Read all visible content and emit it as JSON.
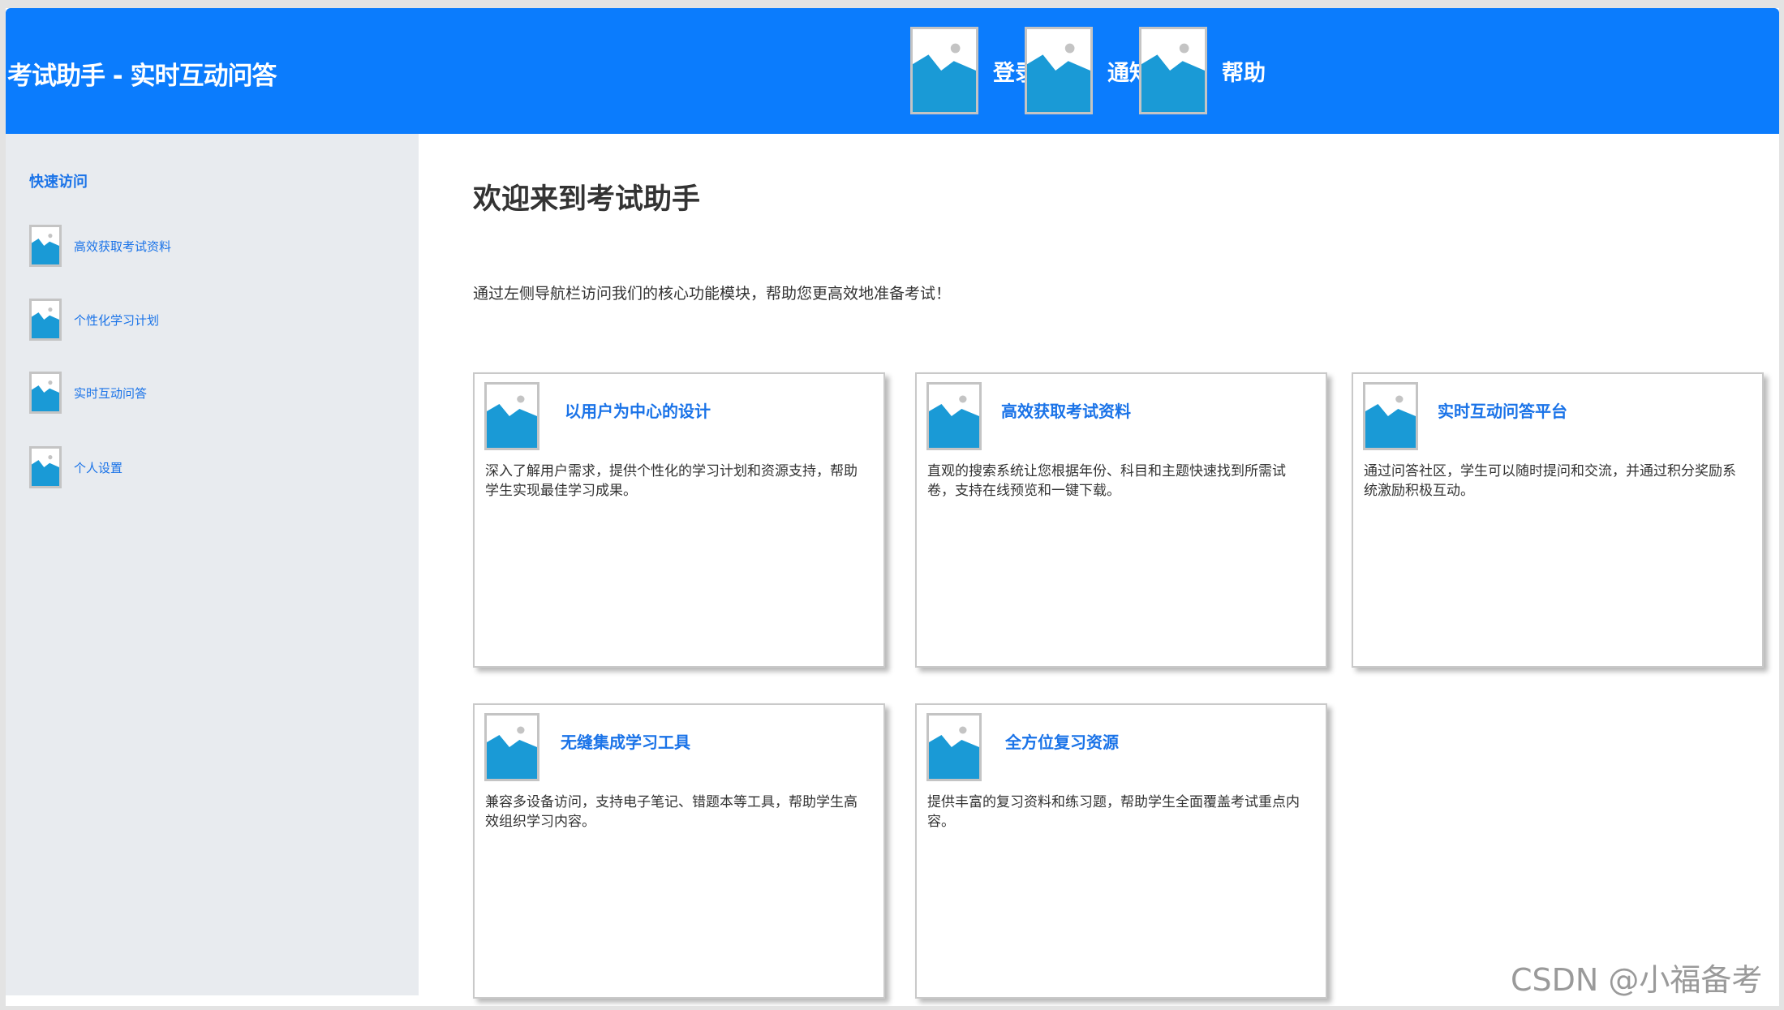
{
  "header": {
    "app_title": "考试助手 - 实时互动问答",
    "nav": [
      {
        "label": "登录",
        "icon": "image-placeholder-icon"
      },
      {
        "label": "通知",
        "icon": "image-placeholder-icon"
      },
      {
        "label": "帮助",
        "icon": "image-placeholder-icon"
      }
    ]
  },
  "sidebar": {
    "heading": "快速访问",
    "items": [
      {
        "label": "高效获取考试资料",
        "icon": "image-placeholder-icon"
      },
      {
        "label": "个性化学习计划",
        "icon": "image-placeholder-icon"
      },
      {
        "label": "实时互动问答",
        "icon": "image-placeholder-icon"
      },
      {
        "label": "个人设置",
        "icon": "image-placeholder-icon"
      }
    ]
  },
  "main": {
    "title": "欢迎来到考试助手",
    "description": "通过左侧导航栏访问我们的核心功能模块，帮助您更高效地准备考试！",
    "cards": [
      {
        "title": "以用户为中心的设计",
        "text": "深入了解用户需求，提供个性化的学习计划和资源支持，帮助学生实现最佳学习成果。"
      },
      {
        "title": "高效获取考试资料",
        "text": "直观的搜索系统让您根据年份、科目和主题快速找到所需试卷，支持在线预览和一键下载。"
      },
      {
        "title": "实时互动问答平台",
        "text": "通过问答社区，学生可以随时提问和交流，并通过积分奖励系统激励积极互动。"
      },
      {
        "title": "无缝集成学习工具",
        "text": "兼容多设备访问，支持电子笔记、错题本等工具，帮助学生高效组织学习内容。"
      },
      {
        "title": "全方位复习资源",
        "text": "提供丰富的复习资料和练习题，帮助学生全面覆盖考试重点内容。"
      }
    ]
  },
  "watermark": "CSDN @小福备考",
  "colors": {
    "header_bg": "#0b7cfd",
    "sidebar_bg": "#e8ebef",
    "link_blue": "#1a73e8",
    "placeholder_fill": "#1a9ad6"
  }
}
